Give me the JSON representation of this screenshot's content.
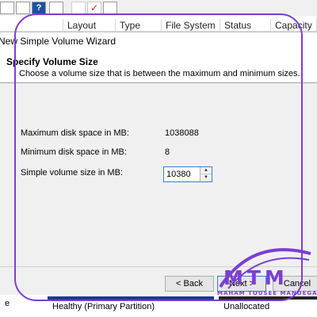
{
  "columns": [
    "Layout",
    "Type",
    "File System",
    "Status",
    "Capacity"
  ],
  "wizard": {
    "title": "New Simple Volume Wizard",
    "heading": "Specify Volume Size",
    "subtitle": "Choose a volume size that is between the maximum and minimum sizes.",
    "max_label": "Maximum disk space in MB:",
    "max_value": "1038088",
    "min_label": "Minimum disk space in MB:",
    "min_value": "8",
    "size_label": "Simple volume size in MB:",
    "size_value": "10380",
    "back_label": "< Back",
    "next_label": "Next >",
    "cancel_label": "Cancel"
  },
  "diskmap": {
    "left_label": "e",
    "partition_status": "Healthy (Primary Partition)",
    "unallocated_label": "Unallocated"
  },
  "logo": {
    "text": "MTM",
    "subtitle": "MAHAM TOUSEE MANDEGAR"
  },
  "colors": {
    "overlay": "#7b3fd1",
    "partition_bar": "#1e3a8a"
  }
}
